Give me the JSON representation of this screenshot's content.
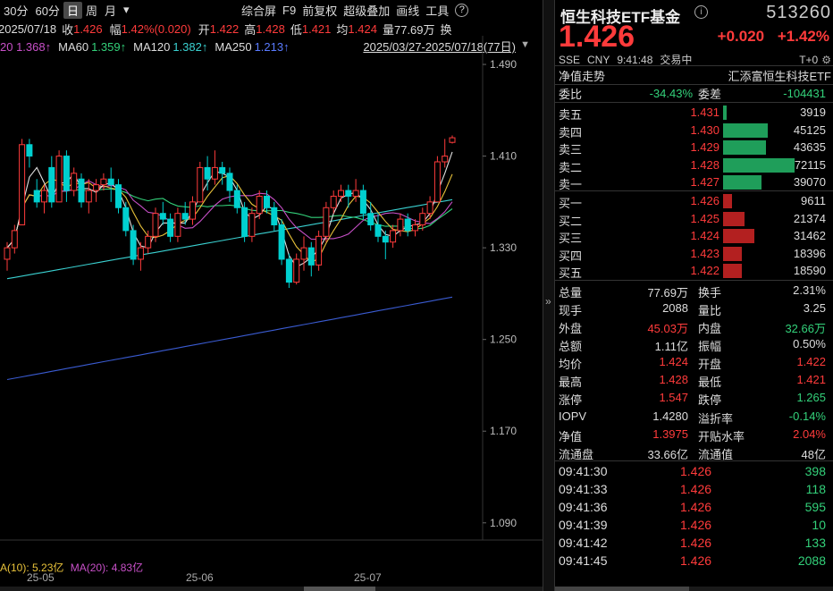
{
  "toolbar": {
    "periods": [
      "30分",
      "60分",
      "日",
      "周",
      "月"
    ],
    "active": "日",
    "more": "▾",
    "date": "2025/07/18",
    "close_label": "收",
    "close": "1.426",
    "amp_label": "幅",
    "amp": "1.42%(0.020)",
    "open_label": "开",
    "open": "1.422",
    "high_label": "高",
    "high": "1.428",
    "low_label": "低",
    "low": "1.421",
    "avg_label": "均",
    "avg": "1.424",
    "vol_label": "量",
    "vol": "77.69万",
    "tools": [
      "综合屏",
      "F9",
      "前复权",
      "超级叠加",
      "画线",
      "工具"
    ],
    "help": "?",
    "cut": "换"
  },
  "ma_row": {
    "ma20": "20 1.368↑",
    "ma60_label": "MA60",
    "ma60": "1.359↑",
    "ma120_label": "MA120",
    "ma120": "1.382↑",
    "ma250_label": "MA250",
    "ma250": "1.213↑"
  },
  "range": "2025/03/27-2025/07/18(77日)",
  "y_ticks": [
    "1.490",
    "1.410",
    "1.330",
    "1.250",
    "1.170",
    "1.090"
  ],
  "vol_indicator": {
    "a": "A(10): 5.23亿",
    "b": "MA(20): 4.83亿"
  },
  "dates": [
    "25-05",
    "25-06",
    "25-07"
  ],
  "colors": {
    "up": "#ff3b3b",
    "down": "#00d0d0",
    "ma5": "#e0e0e0",
    "ma10": "#e8c23a",
    "ma20": "#c850c8",
    "ma60": "#33d17a",
    "ma120": "#3ad1d1",
    "ma250": "#3a5bd1"
  },
  "chart_data": {
    "type": "candlestick",
    "ylim": [
      1.075,
      1.515
    ],
    "candles": [
      [
        1.32,
        1.33,
        1.31,
        1.335
      ],
      [
        1.33,
        1.345,
        1.325,
        1.35
      ],
      [
        1.35,
        1.42,
        1.35,
        1.425
      ],
      [
        1.42,
        1.41,
        1.4,
        1.425
      ],
      [
        1.38,
        1.37,
        1.365,
        1.39
      ],
      [
        1.37,
        1.38,
        1.36,
        1.385
      ],
      [
        1.4,
        1.37,
        1.365,
        1.41
      ],
      [
        1.37,
        1.41,
        1.37,
        1.415
      ],
      [
        1.41,
        1.38,
        1.37,
        1.415
      ],
      [
        1.38,
        1.395,
        1.375,
        1.4
      ],
      [
        1.39,
        1.37,
        1.365,
        1.395
      ],
      [
        1.37,
        1.38,
        1.36,
        1.39
      ],
      [
        1.38,
        1.385,
        1.37,
        1.39
      ],
      [
        1.385,
        1.39,
        1.38,
        1.395
      ],
      [
        1.39,
        1.385,
        1.37,
        1.4
      ],
      [
        1.385,
        1.365,
        1.36,
        1.39
      ],
      [
        1.365,
        1.345,
        1.34,
        1.37
      ],
      [
        1.345,
        1.32,
        1.315,
        1.35
      ],
      [
        1.32,
        1.33,
        1.31,
        1.335
      ],
      [
        1.33,
        1.34,
        1.325,
        1.345
      ],
      [
        1.34,
        1.36,
        1.335,
        1.365
      ],
      [
        1.36,
        1.355,
        1.35,
        1.37
      ],
      [
        1.355,
        1.34,
        1.335,
        1.36
      ],
      [
        1.34,
        1.36,
        1.335,
        1.365
      ],
      [
        1.36,
        1.355,
        1.35,
        1.37
      ],
      [
        1.355,
        1.37,
        1.35,
        1.375
      ],
      [
        1.37,
        1.4,
        1.37,
        1.405
      ],
      [
        1.4,
        1.39,
        1.38,
        1.41
      ],
      [
        1.39,
        1.4,
        1.385,
        1.415
      ],
      [
        1.4,
        1.395,
        1.385,
        1.405
      ],
      [
        1.395,
        1.38,
        1.37,
        1.4
      ],
      [
        1.38,
        1.365,
        1.36,
        1.385
      ],
      [
        1.365,
        1.34,
        1.335,
        1.37
      ],
      [
        1.34,
        1.36,
        1.335,
        1.365
      ],
      [
        1.36,
        1.375,
        1.355,
        1.38
      ],
      [
        1.375,
        1.365,
        1.36,
        1.38
      ],
      [
        1.365,
        1.35,
        1.345,
        1.37
      ],
      [
        1.35,
        1.32,
        1.315,
        1.355
      ],
      [
        1.32,
        1.3,
        1.295,
        1.325
      ],
      [
        1.3,
        1.32,
        1.298,
        1.325
      ],
      [
        1.32,
        1.33,
        1.31,
        1.34
      ],
      [
        1.33,
        1.315,
        1.305,
        1.335
      ],
      [
        1.315,
        1.34,
        1.31,
        1.345
      ],
      [
        1.34,
        1.365,
        1.335,
        1.37
      ],
      [
        1.365,
        1.375,
        1.36,
        1.38
      ],
      [
        1.375,
        1.38,
        1.37,
        1.385
      ],
      [
        1.38,
        1.375,
        1.365,
        1.385
      ],
      [
        1.375,
        1.38,
        1.37,
        1.39
      ],
      [
        1.38,
        1.36,
        1.355,
        1.385
      ],
      [
        1.36,
        1.35,
        1.345,
        1.37
      ],
      [
        1.35,
        1.34,
        1.335,
        1.36
      ],
      [
        1.34,
        1.335,
        1.32,
        1.345
      ],
      [
        1.335,
        1.345,
        1.33,
        1.35
      ],
      [
        1.345,
        1.355,
        1.34,
        1.36
      ],
      [
        1.355,
        1.345,
        1.34,
        1.36
      ],
      [
        1.345,
        1.35,
        1.34,
        1.355
      ],
      [
        1.35,
        1.36,
        1.345,
        1.365
      ],
      [
        1.36,
        1.37,
        1.355,
        1.375
      ],
      [
        1.37,
        1.405,
        1.37,
        1.41
      ],
      [
        1.405,
        1.41,
        1.4,
        1.425
      ],
      [
        1.422,
        1.426,
        1.421,
        1.428
      ]
    ]
  },
  "stock": {
    "name": "恒生科技ETF基金",
    "info_icon": "ⓘ",
    "code": "513260",
    "price": "1.426",
    "change": "+0.020",
    "pct": "+1.42%",
    "exchange": "SSE",
    "currency": "CNY",
    "time": "9:41:48",
    "status": "交易中",
    "t0": "T+0",
    "settings_icon": "⚙",
    "trend_label": "净值走势",
    "fund_name": "汇添富恒生科技ETF",
    "ratio_label": "委比",
    "ratio": "-34.43%",
    "diff_label": "委差",
    "diff": "-104431"
  },
  "orderbook": {
    "asks": [
      {
        "label": "卖五",
        "price": "1.431",
        "qty": "3919",
        "frac": 0.05
      },
      {
        "label": "卖四",
        "price": "1.430",
        "qty": "45125",
        "frac": 0.63
      },
      {
        "label": "卖三",
        "price": "1.429",
        "qty": "43635",
        "frac": 0.6
      },
      {
        "label": "卖二",
        "price": "1.428",
        "qty": "72115",
        "frac": 1.0
      },
      {
        "label": "卖一",
        "price": "1.427",
        "qty": "39070",
        "frac": 0.54
      }
    ],
    "bids": [
      {
        "label": "买一",
        "price": "1.426",
        "qty": "9611",
        "frac": 0.13
      },
      {
        "label": "买二",
        "price": "1.425",
        "qty": "21374",
        "frac": 0.3
      },
      {
        "label": "买三",
        "price": "1.424",
        "qty": "31462",
        "frac": 0.44
      },
      {
        "label": "买四",
        "price": "1.423",
        "qty": "18396",
        "frac": 0.26
      },
      {
        "label": "买五",
        "price": "1.422",
        "qty": "18590",
        "frac": 0.26
      }
    ]
  },
  "stats": [
    {
      "l1": "总量",
      "v1": "77.69万",
      "c1": "white",
      "l2": "换手",
      "v2": "2.31%",
      "c2": "white"
    },
    {
      "l1": "现手",
      "v1": "2088",
      "c1": "white",
      "l2": "量比",
      "v2": "3.25",
      "c2": "white"
    },
    {
      "l1": "外盘",
      "v1": "45.03万",
      "c1": "red",
      "l2": "内盘",
      "v2": "32.66万",
      "c2": "green"
    },
    {
      "l1": "总额",
      "v1": "1.11亿",
      "c1": "white",
      "l2": "振幅",
      "v2": "0.50%",
      "c2": "white"
    },
    {
      "l1": "均价",
      "v1": "1.424",
      "c1": "red",
      "l2": "开盘",
      "v2": "1.422",
      "c2": "red"
    },
    {
      "l1": "最高",
      "v1": "1.428",
      "c1": "red",
      "l2": "最低",
      "v2": "1.421",
      "c2": "red"
    },
    {
      "l1": "涨停",
      "v1": "1.547",
      "c1": "red",
      "l2": "跌停",
      "v2": "1.265",
      "c2": "green"
    },
    {
      "l1": "IOPV",
      "v1": "1.4280",
      "c1": "white",
      "l2": "溢折率",
      "v2": "-0.14%",
      "c2": "green"
    },
    {
      "l1": "净值",
      "v1": "1.3975",
      "c1": "red",
      "l2": "开贴水率",
      "v2": "2.04%",
      "c2": "red"
    },
    {
      "l1": "流通盘",
      "v1": "33.66亿",
      "c1": "white",
      "l2": "流通值",
      "v2": "48亿",
      "c2": "white"
    }
  ],
  "ticks": [
    {
      "time": "09:41:30",
      "price": "1.426",
      "vol": "398"
    },
    {
      "time": "09:41:33",
      "price": "1.426",
      "vol": "118"
    },
    {
      "time": "09:41:36",
      "price": "1.426",
      "vol": "595"
    },
    {
      "time": "09:41:39",
      "price": "1.426",
      "vol": "10"
    },
    {
      "time": "09:41:42",
      "price": "1.426",
      "vol": "133"
    },
    {
      "time": "09:41:45",
      "price": "1.426",
      "vol": "2088"
    }
  ]
}
